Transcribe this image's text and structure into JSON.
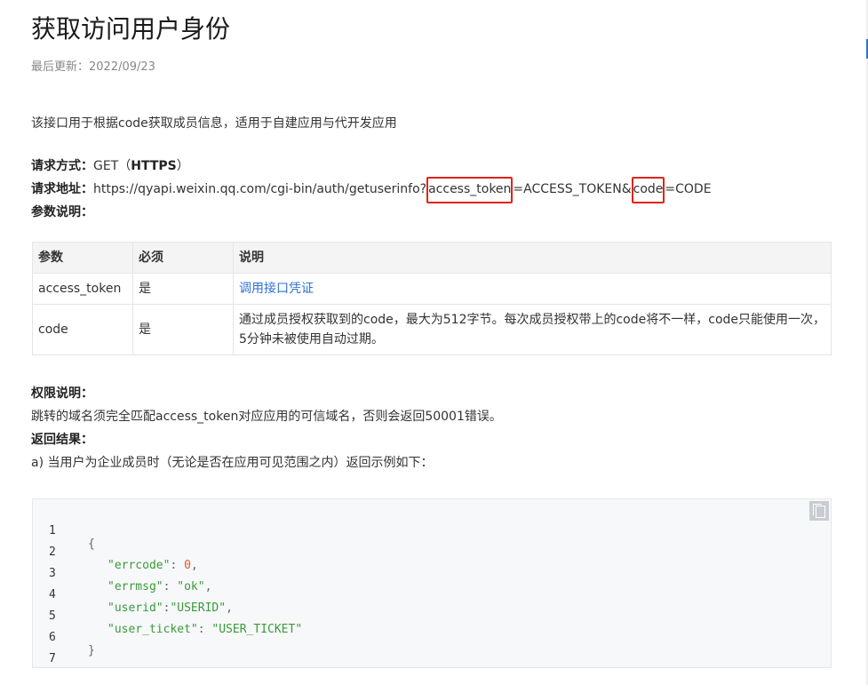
{
  "title": "获取访问用户身份",
  "updated": "最后更新：2022/09/23",
  "intro": "该接口用于根据code获取成员信息，适用于自建应用与代开发应用",
  "request": {
    "method_label": "请求方式：",
    "method_value": "GET（",
    "method_https": "HTTPS",
    "method_close": "）",
    "url_label": "请求地址：",
    "url_prefix": "https://qyapi.weixin.qq.com/cgi-bin/auth/getuserinfo?",
    "url_token": "access_token",
    "url_mid": "=ACCESS_TOKEN&",
    "url_code": "code",
    "url_end": "=CODE",
    "params_label": "参数说明："
  },
  "table": {
    "headers": [
      "参数",
      "必须",
      "说明"
    ],
    "rows": [
      {
        "param": "access_token",
        "required": "是",
        "desc": "调用接口凭证"
      },
      {
        "param": "code",
        "required": "是",
        "desc": "通过成员授权获取到的code，最大为512字节。每次成员授权带上的code将不一样，code只能使用一次，5分钟未被使用自动过期。"
      }
    ]
  },
  "permission": {
    "label": "权限说明：",
    "text": "跳转的域名须完全匹配access_token对应应用的可信域名，否则会返回50001错误。"
  },
  "result": {
    "label": "返回结果：",
    "text": "a) 当用户为企业成员时（无论是否在应用可见范围之内）返回示例如下："
  },
  "code": {
    "line_numbers": [
      "1",
      "2",
      "3",
      "4",
      "5",
      "6",
      "7"
    ],
    "l1": "{",
    "l2_key": "\"errcode\"",
    "l2_sep": ": ",
    "l2_val": "0",
    "l2_end": ",",
    "l3_key": "\"errmsg\"",
    "l3_sep": ": ",
    "l3_val": "\"ok\"",
    "l3_end": ",",
    "l4_key": "\"userid\"",
    "l4_sep": ":",
    "l4_val": "\"USERID\"",
    "l4_end": ",",
    "l5_key": "\"user_ticket\"",
    "l5_sep": ": ",
    "l5_val": "\"USER_TICKET\"",
    "l6": "}"
  },
  "icons": {
    "copy": "copy-icon"
  },
  "colors": {
    "highlight": "#e0231c",
    "link": "#2f6fd6",
    "json_string": "#3a9a3a",
    "json_number": "#e0592c"
  }
}
